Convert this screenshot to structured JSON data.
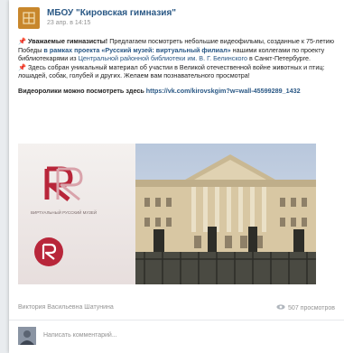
{
  "post": {
    "group_name": "МБОУ \"Кировская гимназия\"",
    "date": "23 апр. в 14:15",
    "paragraph1": {
      "lead_bold": "Уважаемые гимназисты!",
      "t1": " Предлагаем посмотреть небольшие видеофильмы, созданные к 75-летию Победы ",
      "link1": "в рамках проекта «Русский музей: виртуальный филиал»",
      "t2": " нашими коллегами по проекту библиотекарями из ",
      "link2": "Центральной районной библиотеки им. В. Г. Белинского",
      "t3": " в Санкт-Петербурге."
    },
    "paragraph2": "Здесь собран уникальный материал об участии в Великой отечественной войне животных и птиц: лошадей, собак, голубей и других. Желаем вам познавательного просмотра!",
    "paragraph3": {
      "bold": "Видеоролики можно посмотреть здесь",
      "link": "https://vk.com/kirovskgim?w=wall-45599289_1432"
    },
    "logo_text": "ВИРТУАЛЬНЫЙ РУССКИЙ МУЗЕЙ",
    "author": "Виктория Васильевна Шатунина",
    "views": "507 просмотров",
    "comment_placeholder": "Написать комментарий..."
  },
  "colors": {
    "link": "#2a5885",
    "accent_red": "#b8263a",
    "pin": "#d0342c",
    "muted": "#939393"
  },
  "icons": [
    "pin-icon",
    "eye-icon",
    "group-logo-icon"
  ]
}
